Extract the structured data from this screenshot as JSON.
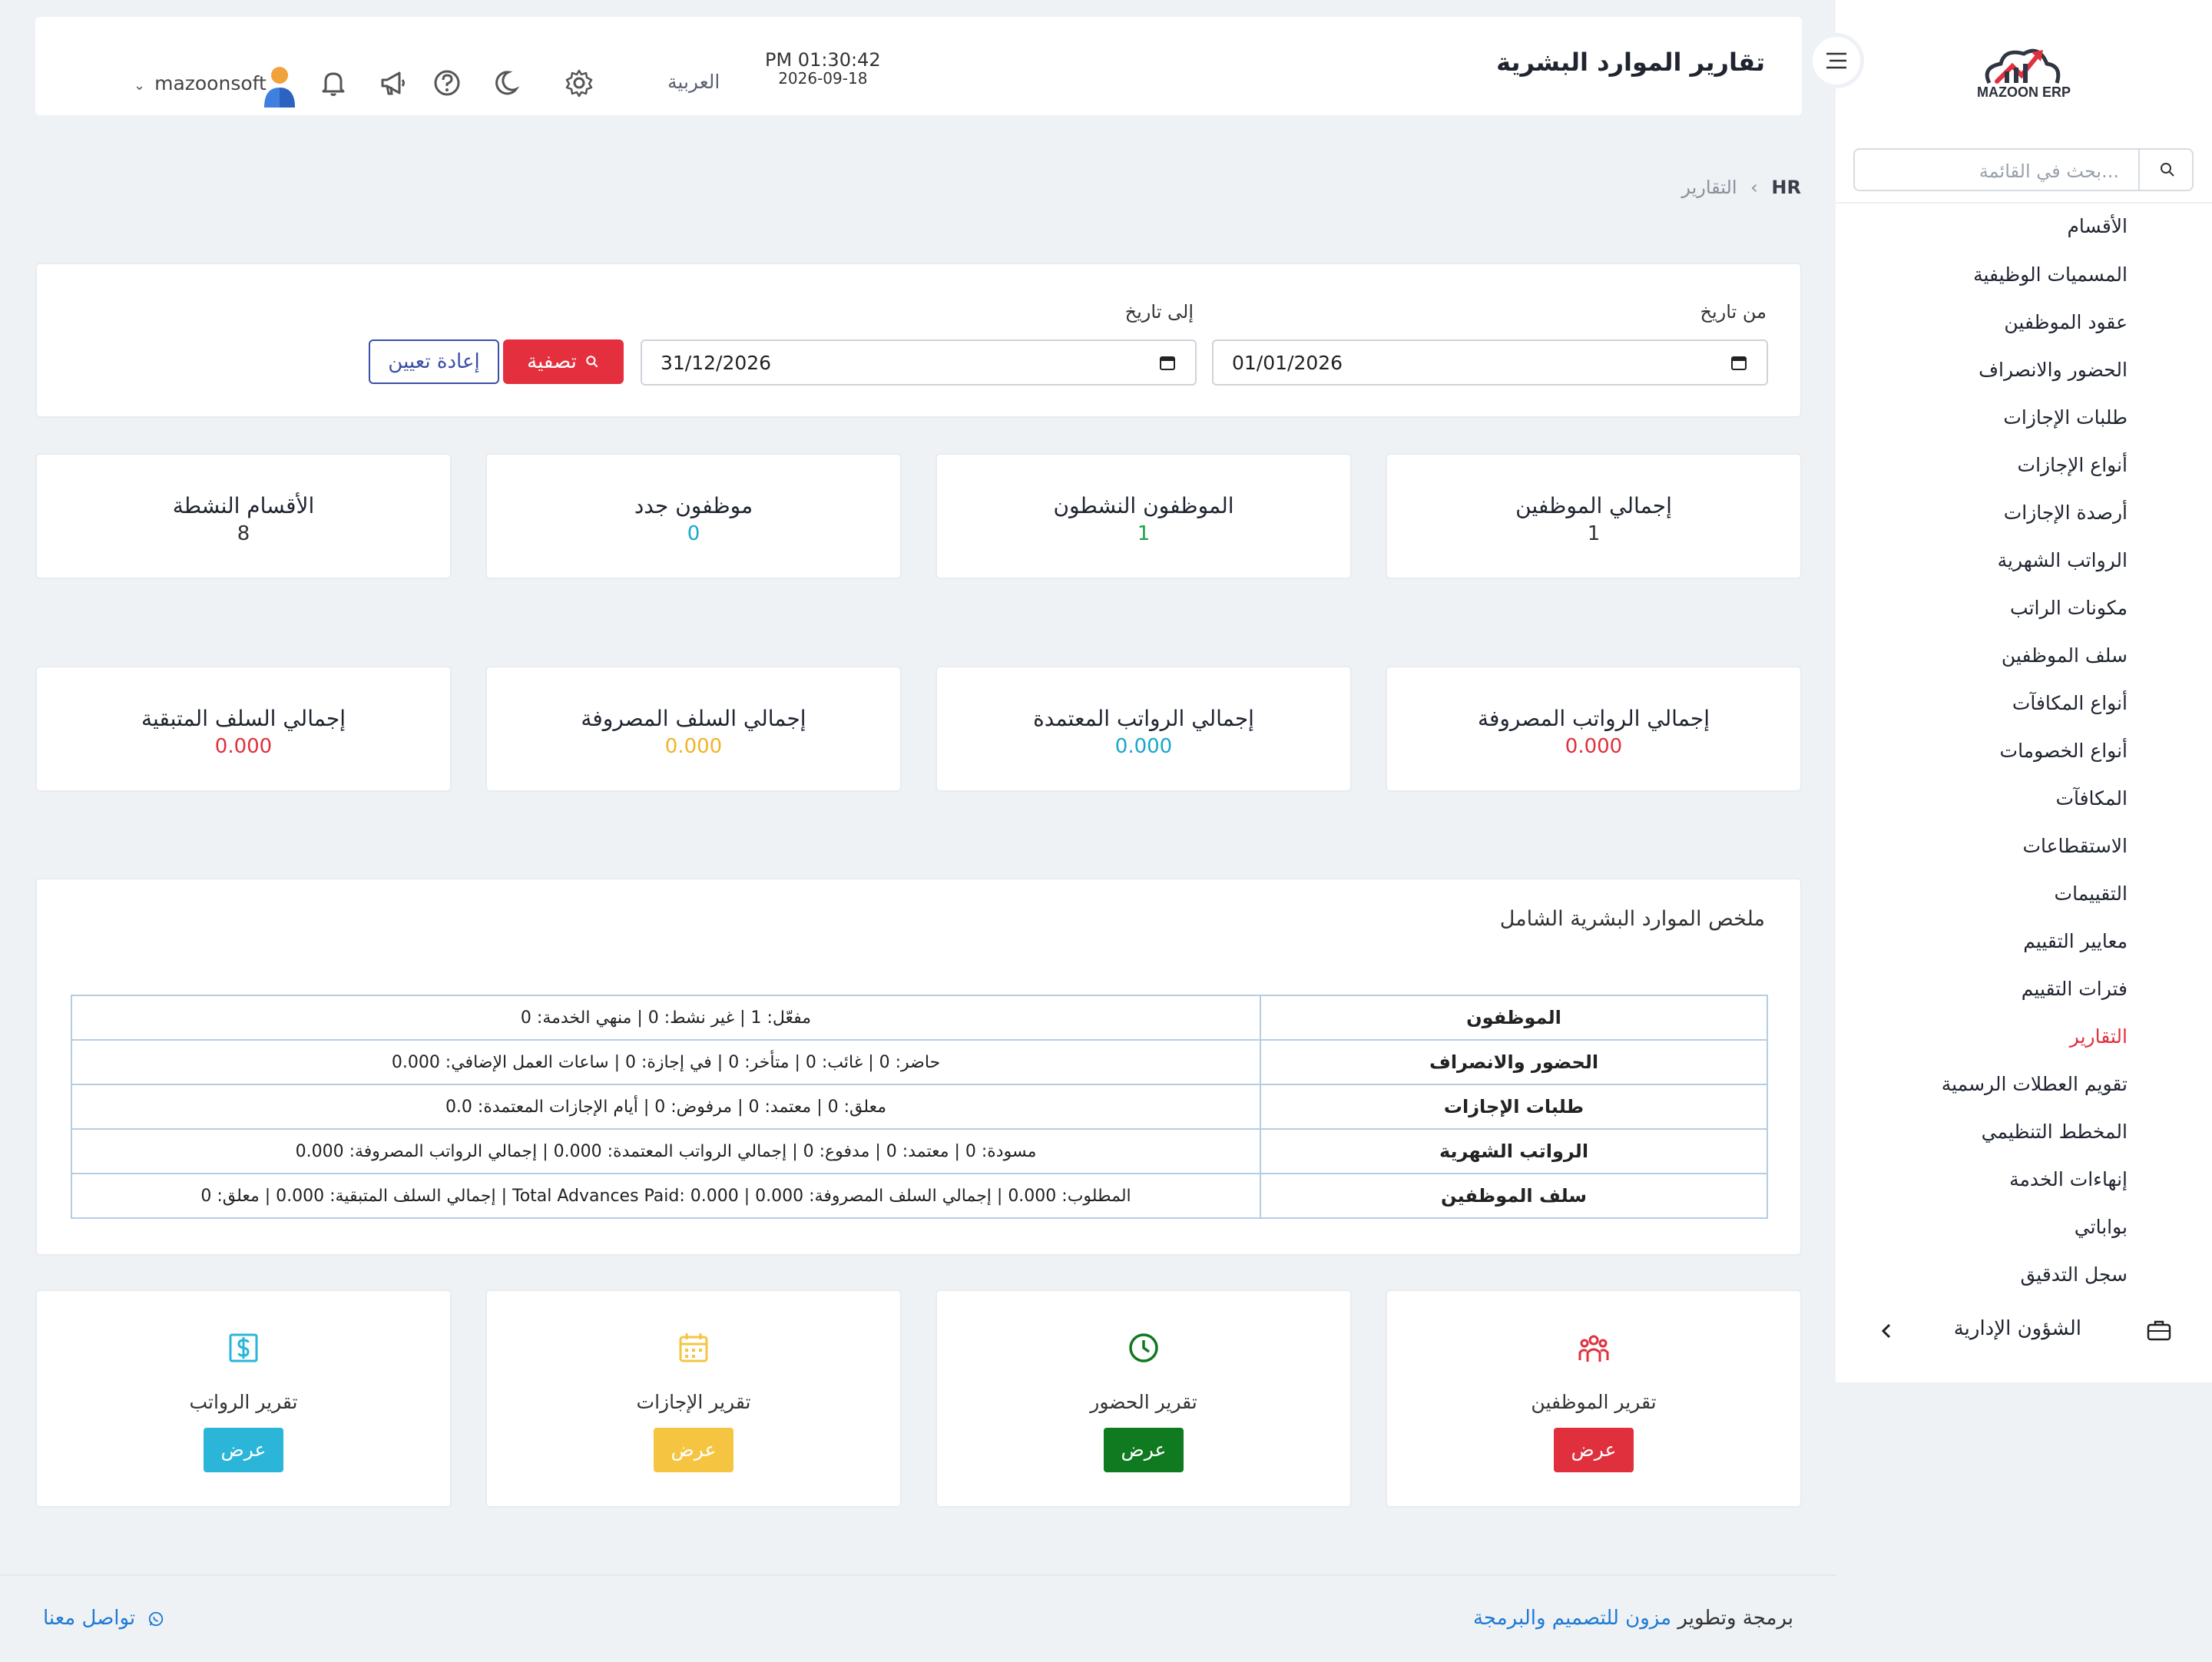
{
  "brand": {
    "logo_text": "MAZOON ERP",
    "logo_small": "ERP ERP"
  },
  "sidebar": {
    "search_placeholder": "بحث في القائمة...",
    "items": [
      {
        "label": "الأقسام"
      },
      {
        "label": "المسميات الوظيفية"
      },
      {
        "label": "عقود الموظفين"
      },
      {
        "label": "الحضور والانصراف"
      },
      {
        "label": "طلبات الإجازات"
      },
      {
        "label": "أنواع الإجازات"
      },
      {
        "label": "أرصدة الإجازات"
      },
      {
        "label": "الرواتب الشهرية"
      },
      {
        "label": "مكونات الراتب"
      },
      {
        "label": "سلف الموظفين"
      },
      {
        "label": "أنواع المكافآت"
      },
      {
        "label": "أنواع الخصومات"
      },
      {
        "label": "المكافآت"
      },
      {
        "label": "الاستقطاعات"
      },
      {
        "label": "التقييمات"
      },
      {
        "label": "معايير التقييم"
      },
      {
        "label": "فترات التقييم"
      },
      {
        "label": "التقارير",
        "active": true
      },
      {
        "label": "تقويم العطلات الرسمية"
      },
      {
        "label": "المخطط التنظيمي"
      },
      {
        "label": "إنهاءات الخدمة"
      },
      {
        "label": "بواباتي"
      },
      {
        "label": "سجل التدقيق"
      }
    ],
    "admin_section": "الشؤون الإدارية"
  },
  "header": {
    "title": "تقارير الموارد البشرية",
    "time": "PM 01:30:42",
    "date": "2026-09-18",
    "language": "العربية",
    "username": "mazoonsoft"
  },
  "breadcrumb": {
    "root": "HR",
    "current": "التقارير",
    "separator": "‹"
  },
  "filter": {
    "from_label": "من تاريخ",
    "from_value": "01/01/2026",
    "to_label": "إلى تاريخ",
    "to_value": "31/12/2026",
    "filter_button": "تصفية",
    "reset_button": "إعادة تعيين"
  },
  "stats_row1": [
    {
      "title": "إجمالي الموظفين",
      "value": "1",
      "color": "#333333"
    },
    {
      "title": "الموظفون النشطون",
      "value": "1",
      "color": "#19a34a"
    },
    {
      "title": "موظفون جدد",
      "value": "0",
      "color": "#17a8c9"
    },
    {
      "title": "الأقسام النشطة",
      "value": "8",
      "color": "#333333"
    }
  ],
  "stats_row2": [
    {
      "title": "إجمالي الرواتب المصروفة",
      "value": "0.000",
      "color": "#e0303e"
    },
    {
      "title": "إجمالي الرواتب المعتمدة",
      "value": "0.000",
      "color": "#17a8c9"
    },
    {
      "title": "إجمالي السلف المصروفة",
      "value": "0.000",
      "color": "#f0b429"
    },
    {
      "title": "إجمالي السلف المتبقية",
      "value": "0.000",
      "color": "#e0303e"
    }
  ],
  "summary": {
    "title": "ملخص الموارد البشرية الشامل",
    "rows": [
      {
        "key": "الموظفون",
        "value": "مفعّل: 1 | غير نشط: 0 | منهي الخدمة: 0"
      },
      {
        "key": "الحضور والانصراف",
        "value": "حاضر: 0 | غائب: 0 | متأخر: 0 | في إجازة: 0 | ساعات العمل الإضافي: 0.000"
      },
      {
        "key": "طلبات الإجازات",
        "value": "معلق: 0 | معتمد: 0 | مرفوض: 0 | أيام الإجازات المعتمدة: 0.0"
      },
      {
        "key": "الرواتب الشهرية",
        "value": "مسودة: 0 | معتمد: 0 | مدفوع: 0 | إجمالي الرواتب المعتمدة: 0.000 | إجمالي الرواتب المصروفة: 0.000"
      },
      {
        "key": "سلف الموظفين",
        "value": "المطلوب: 0.000 | إجمالي السلف المصروفة: 0.000 | Total Advances Paid: 0.000 | إجمالي السلف المتبقية: 0.000 | معلق: 0"
      }
    ]
  },
  "reports": [
    {
      "title": "تقرير الموظفين",
      "button": "عرض",
      "icon": "users-icon",
      "color": "#e0303e"
    },
    {
      "title": "تقرير الحضور",
      "button": "عرض",
      "icon": "clock-icon",
      "color": "#0f7a1f"
    },
    {
      "title": "تقرير الإجازات",
      "button": "عرض",
      "icon": "calendar-icon",
      "color": "#f5c542"
    },
    {
      "title": "تقرير الرواتب",
      "button": "عرض",
      "icon": "dollar-icon",
      "color": "#2bb5d9"
    }
  ],
  "footer": {
    "prefix": "برمجة وتطوير",
    "company": "مزون للتصميم والبرمجة",
    "contact": "تواصل معنا"
  }
}
